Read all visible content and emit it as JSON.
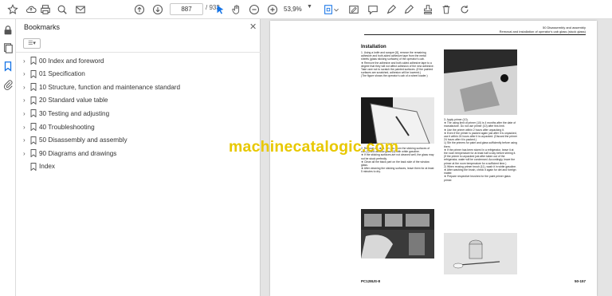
{
  "toolbar": {
    "page_current": "887",
    "page_total": "/ 933",
    "zoom": "53,9%"
  },
  "panel": {
    "title": "Bookmarks",
    "options_label": "☰▾"
  },
  "bookmarks": [
    {
      "label": "00 Index and foreword",
      "expandable": true
    },
    {
      "label": "01 Specification",
      "expandable": true
    },
    {
      "label": "10 Structure, function and maintenance standard",
      "expandable": true
    },
    {
      "label": "20 Standard value table",
      "expandable": true
    },
    {
      "label": "30 Testing and adjusting",
      "expandable": true
    },
    {
      "label": "40 Troubleshooting",
      "expandable": true
    },
    {
      "label": "50 Disassembly and assembly",
      "expandable": true
    },
    {
      "label": "90 Diagrams and drawings",
      "expandable": true
    },
    {
      "label": "Index",
      "expandable": false
    }
  ],
  "document": {
    "header_line1": "50 Disassembly and assembly",
    "header_line2": "Removal and installation of operator's cab glass (stuck glass)",
    "section_title": "Installation",
    "col1_text_a": "1. Using a knife and scraper [8], remove the remaining adhesive and both-sided adhesive tape from the metal sheets (glass sticking surfaces) of the operator's cab.\n★ Remove the adhesive and both-sided adhesive tape to a degree that they will not affect adhesion of the new adhesive. Take care not to scratch the painted surfaces. (If the painted surfaces are scratched, adhesion will be lowered.)\n(The figure shows the operator's cab of a wheel loader.)",
    "col1_text_b": "2. Remove oil, dust, dirt, etc. from the sticking surfaces of cab (3) and window glass (4) with white gasoline.\n★ If the sticking surfaces are not cleaned well, the glass may not be stuck perfectly.\n★ Clean all the black part on the back side of the window glass.\n★ After cleaning the sticking surfaces, leave them for at least 5 minutes to dry.",
    "col2_text_a": "3. Apply primer (10).\n★ The using limit of primer (10) is 4 months after the date of manufacture. Do not use primer (10) after this limit.\n★ Use the primer within 2 hours after unpacking it.\n★ Even if the primer is packed again just after it is unpacked, use it within 24 hours after it is unpacked. (Discard the primer 24 hours after it is packed.)\n1) Stir the primers for paint and glass sufficiently before using them.\n★ If the primer has been stored in a refrigerator, leave it at the room temperature for at least half a day before stirring it. (If the primer is unpacked just after taken out of the refrigerator, water will be condensed. Accordingly, leave the primer at the room temperature for a sufficient time.)\n2) When reusing primer brush (11), wash it in white gasoline.\n★ After washing the brush, check it again for dirt and foreign matter.\n★ Prepare respective brushes for the paint primer glass primer.",
    "footer_left": "PC128US-8",
    "footer_right": "50-157"
  },
  "watermark": "machinecatalogic.com",
  "colors": {
    "watermark": "#e8c800",
    "doc_background": "#e4e4e4",
    "accent_blue": "#1473e6"
  }
}
